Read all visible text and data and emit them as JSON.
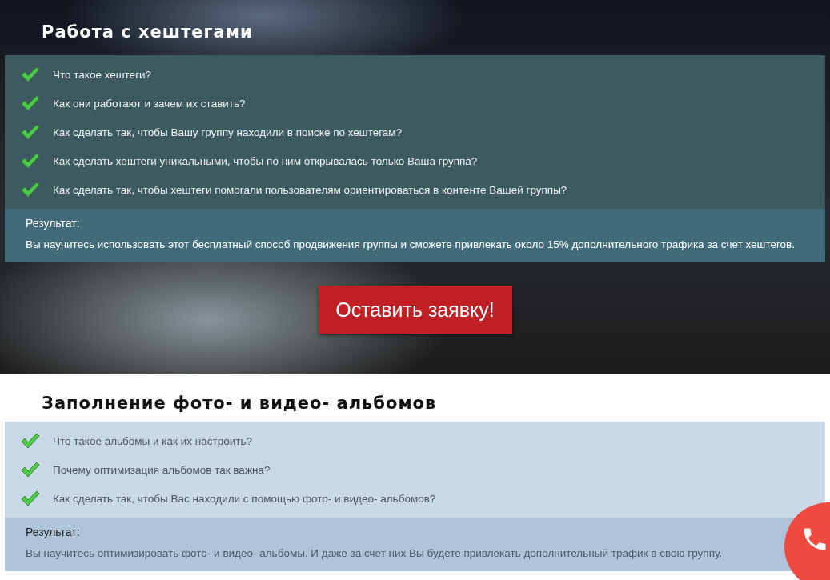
{
  "sections": [
    {
      "kind": "dark",
      "title": "Работа с хештегами",
      "items": [
        {
          "text": "Что такое хештеги?"
        },
        {
          "text": "Как они работают и зачем их ставить?"
        },
        {
          "text": "Как сделать так, чтобы Вашу группу находили в поиске по хештегам?"
        },
        {
          "text": "Как сделать хештеги уникальными, чтобы по ним открывалась только Ваша группа?"
        },
        {
          "text": " Как сделать так, чтобы хештеги помогали пользователям ориентироваться в контенте Вашей группы?"
        }
      ],
      "result_label": "Результат:",
      "result_text": "Вы научитесь использовать этот бесплатный способ продвижения группы и сможете привлекать около 15% дополнительного трафика за счет хештегов.",
      "button": "Оставить заявку!"
    },
    {
      "kind": "light",
      "title": "Заполнение фото- и видео- альбомов",
      "items": [
        {
          "text": "Что такое альбомы и как их настроить?"
        },
        {
          "text": "Почему оптимизация альбомов так важна?"
        },
        {
          "text": "Как сделать так, чтобы Вас находили с помощью фото- и видео- альбомов?"
        }
      ],
      "result_label": "Результат:",
      "result_text": "Вы научитесь оптимизировать фото- и видео- альбомы. И даже за счет них Вы будете привлекать дополнительный трафик в свою группу."
    }
  ]
}
